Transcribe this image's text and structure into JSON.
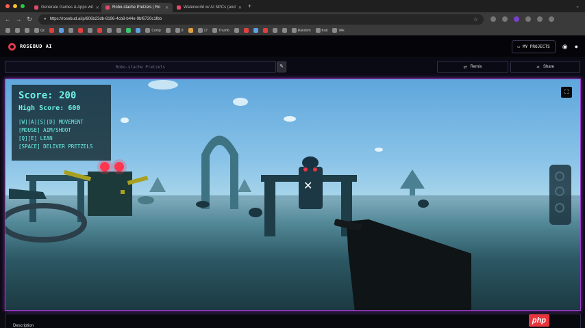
{
  "browser": {
    "tabs": [
      {
        "title": "Generate Games & Apps wit",
        "active": false
      },
      {
        "title": "Robo-stache Pretzels | Ro",
        "active": true
      },
      {
        "title": "Waterworld w/ AI NPCs (and",
        "active": false
      }
    ],
    "url": "https://rosebud.ai/p/606b23db-8196-4cb8-b44e-9bf6720c1fbb",
    "bookmarks": [
      "Qc",
      "Comp",
      "8",
      "17",
      "Thumb",
      "Random",
      "Kub",
      "Wik"
    ]
  },
  "site": {
    "logo_text": "ROSEBUD AI",
    "my_projects_label": "MY PROJECTS"
  },
  "project": {
    "name": "Robo-stache Pretzels",
    "remix_label": "Remix",
    "share_label": "Share"
  },
  "game": {
    "score_text": "Score: 200",
    "high_score_text": "High Score: 600",
    "controls": [
      "[W][A][S][D] MOVEMENT",
      "[MOUSE] AIM/SHOOT",
      "[Q][E] LEAN",
      "[SPACE] DELIVER PRETZELS"
    ]
  },
  "description": {
    "label": "Description"
  },
  "watermark": "php",
  "colors": {
    "accent_border": "#9a3bc4",
    "hud_text": "#6ef2e6",
    "logo_red": "#e23a4d"
  },
  "icons": [
    "lock-icon",
    "star-icon",
    "edit-icon",
    "remix-icon",
    "share-icon",
    "fullscreen-icon",
    "crosshair-icon",
    "discord-icon",
    "user-icon"
  ]
}
